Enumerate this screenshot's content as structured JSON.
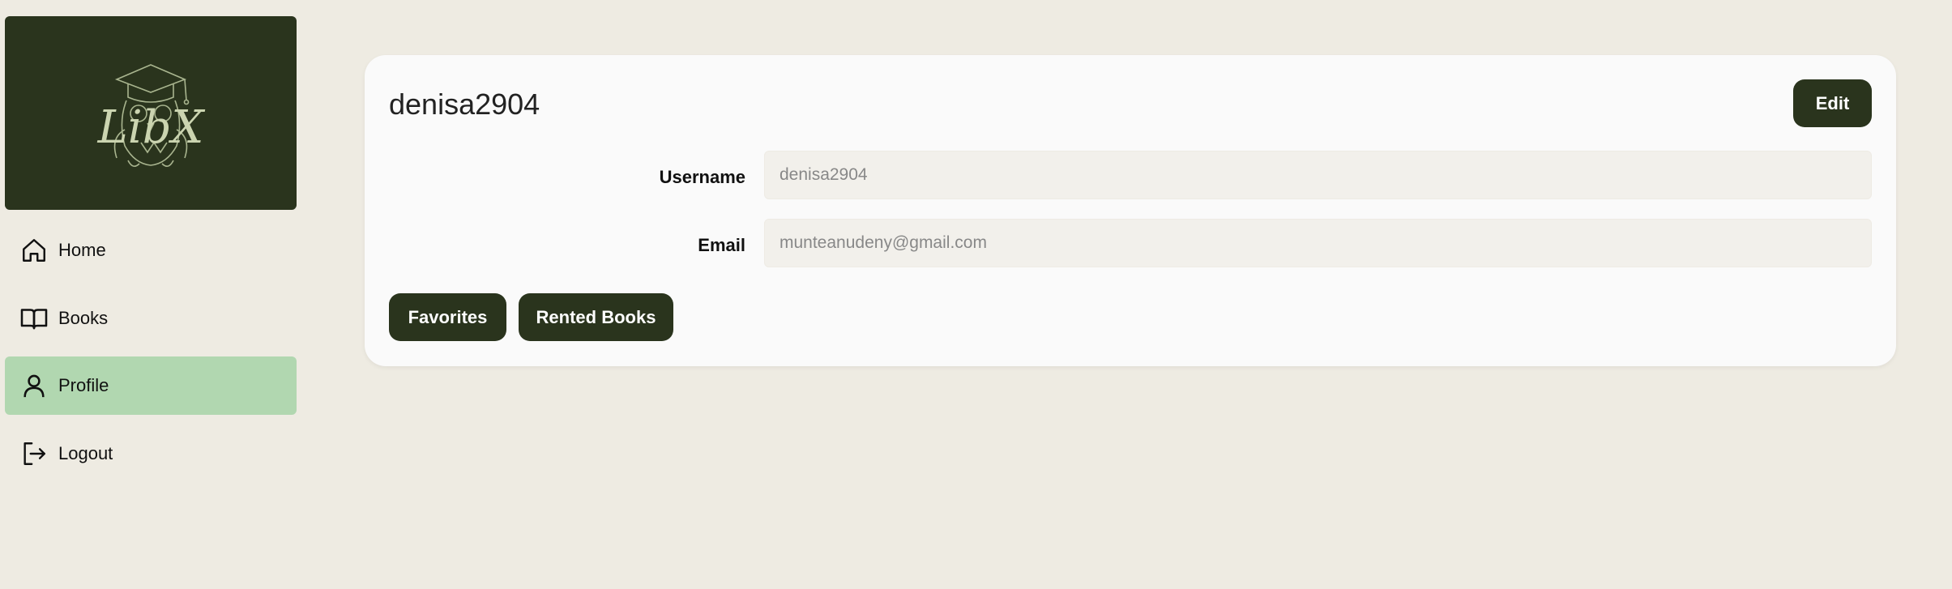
{
  "sidebar": {
    "logo_text": "LibX",
    "items": [
      {
        "label": "Home",
        "icon": "home-icon"
      },
      {
        "label": "Books",
        "icon": "book-open-icon"
      },
      {
        "label": "Profile",
        "icon": "user-icon",
        "active": true
      },
      {
        "label": "Logout",
        "icon": "logout-icon"
      }
    ]
  },
  "profile": {
    "title": "denisa2904",
    "edit_label": "Edit",
    "fields": {
      "username_label": "Username",
      "username_value": "denisa2904",
      "email_label": "Email",
      "email_value": "munteanudeny@gmail.com"
    },
    "favorites_label": "Favorites",
    "rented_books_label": "Rented Books"
  },
  "colors": {
    "background": "#eeebe2",
    "brand_dark": "#2a341d",
    "active_nav": "#b1d7b0",
    "card": "#fafafa",
    "input_bg": "#f2f0eb"
  }
}
